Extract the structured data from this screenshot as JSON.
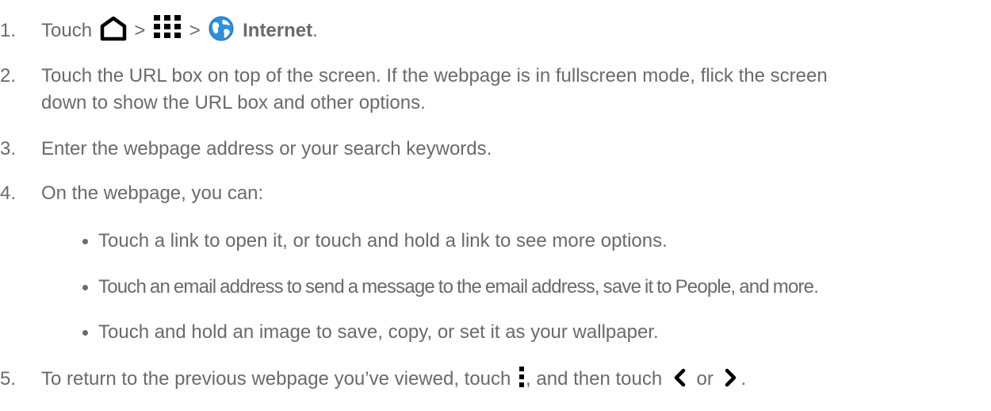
{
  "steps": [
    {
      "num": "1.",
      "prefix": "Touch",
      "sep1": ">",
      "sep2": ">",
      "app": "Internet",
      "suffix": "."
    },
    {
      "num": "2.",
      "line1": "Touch the URL box on top of the screen. If the webpage is in fullscreen mode, flick the screen",
      "line2": "down to show the URL box and other options."
    },
    {
      "num": "3.",
      "text": "Enter the webpage address or your search keywords."
    },
    {
      "num": "4.",
      "text": "On the webpage, you can:"
    },
    {
      "num": "5.",
      "prefix": "To return to the previous webpage you’ve viewed, touch",
      "mid": ", and then touch",
      "or": "or",
      "suffix": "."
    }
  ],
  "bullets": [
    "Touch a link to open it, or touch and hold a link to see more options.",
    "Touch an email address to send a message to the email address, save it to People, and more.",
    "Touch and hold an image to save, copy, or set it as your wallpaper."
  ],
  "icons": {
    "home": "home-icon",
    "apps": "apps-grid-icon",
    "internet": "globe-icon",
    "menu": "menu-icon",
    "back": "chevron-left-icon",
    "forward": "chevron-right-icon"
  }
}
